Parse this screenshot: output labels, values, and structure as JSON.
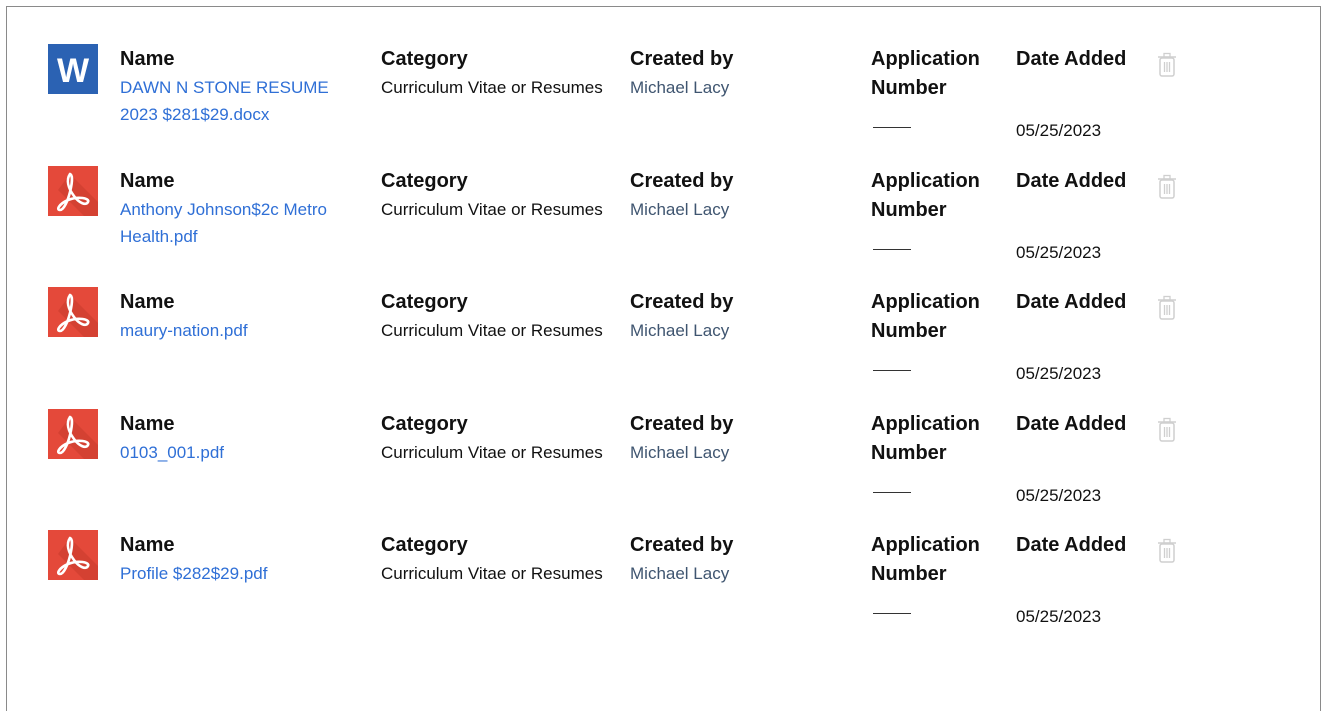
{
  "labels": {
    "name": "Name",
    "category": "Category",
    "created_by": "Created by",
    "application_number": "Application Number",
    "date_added": "Date Added"
  },
  "documents": [
    {
      "file_type": "word",
      "icon": "word-icon",
      "name": "DAWN N STONE RESUME 2023 $281$29.docx",
      "category": "Curriculum Vitae or Resumes",
      "created_by": "Michael Lacy",
      "application_number": "",
      "date_added": "05/25/2023"
    },
    {
      "file_type": "pdf",
      "icon": "pdf-icon",
      "name": "Anthony Johnson$2c Metro Health.pdf",
      "category": "Curriculum Vitae or Resumes",
      "created_by": "Michael Lacy",
      "application_number": "",
      "date_added": "05/25/2023"
    },
    {
      "file_type": "pdf",
      "icon": "pdf-icon",
      "name": "maury-nation.pdf",
      "category": "Curriculum Vitae or Resumes",
      "created_by": "Michael Lacy",
      "application_number": "",
      "date_added": "05/25/2023"
    },
    {
      "file_type": "pdf",
      "icon": "pdf-icon",
      "name": "0103_001.pdf",
      "category": "Curriculum Vitae or Resumes",
      "created_by": "Michael Lacy",
      "application_number": "",
      "date_added": "05/25/2023"
    },
    {
      "file_type": "pdf",
      "icon": "pdf-icon",
      "name": "Profile $282$29.pdf",
      "category": "Curriculum Vitae or Resumes",
      "created_by": "Michael Lacy",
      "application_number": "",
      "date_added": "05/25/2023"
    }
  ],
  "colors": {
    "link": "#2f6fd6",
    "creator": "#3f5570",
    "word_blue": "#2b62b3",
    "pdf_red": "#e4493a",
    "trash_gray": "#cfcfcf"
  }
}
